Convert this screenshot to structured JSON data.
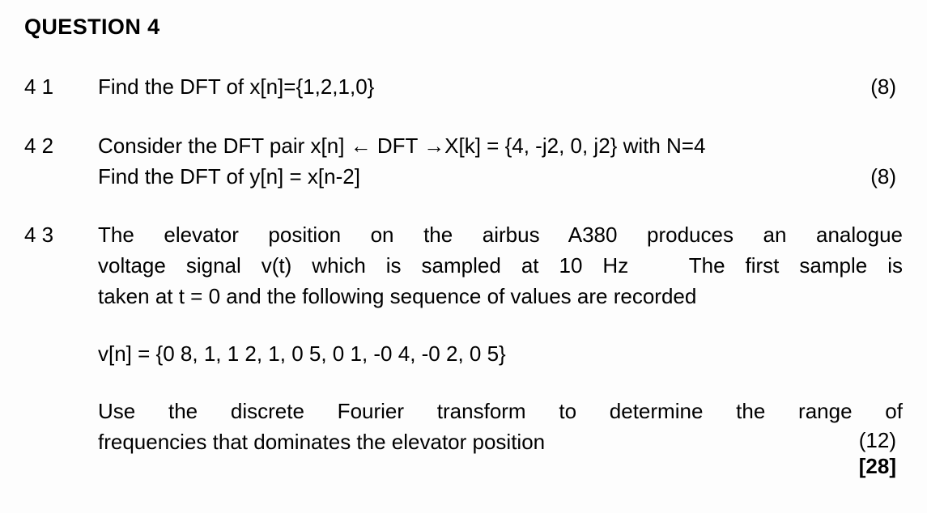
{
  "document": {
    "heading": "QUESTION 4",
    "questions": [
      {
        "number": "4 1",
        "lines": [
          "Find the DFT of x[n]={1,2,1,0}"
        ],
        "marks": "(8)"
      },
      {
        "number": "4 2",
        "lines": [
          "Consider the DFT pair x[n] ← DFT →X[k] = {4, -j2, 0, j2} with N=4",
          "Find the DFT of y[n] = x[n-2]"
        ],
        "marks": "(8)"
      },
      {
        "number": "4 3",
        "paragraph1_lines": [
          "The elevator position on the airbus A380 produces an analogue",
          "voltage signal v(t) which is sampled at 10 Hz   The first sample is",
          "taken at t = 0 and the following sequence of values are recorded"
        ],
        "sequence": "v[n] = {0 8, 1, 1 2, 1, 0 5, 0 1, -0 4, -0 2, 0 5}",
        "paragraph2_lines": [
          "Use the discrete Fourier transform to determine the range of",
          "frequencies that dominates the elevator position"
        ],
        "marks": "(12)"
      }
    ],
    "total_marks": "[28]"
  }
}
